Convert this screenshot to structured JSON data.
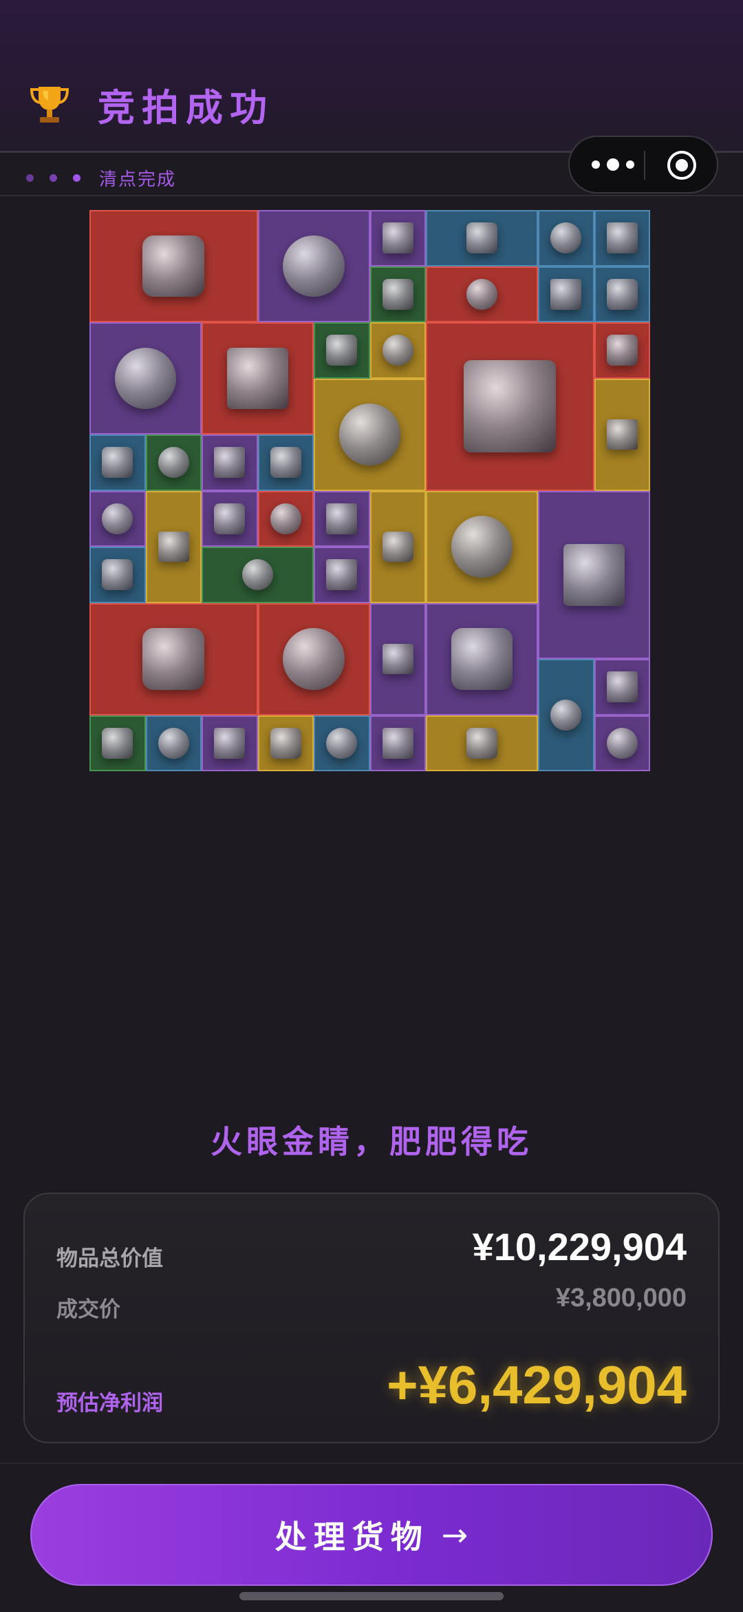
{
  "header": {
    "title": "竞拍成功",
    "subtitle": "清点完成",
    "trophy_icon": "trophy-icon"
  },
  "capsule": {
    "more_icon": "more-dots-icon",
    "close_icon": "target-close-icon"
  },
  "items_grid": {
    "rarity_colors": {
      "red": "#a8342e",
      "purple": "#5d3b83",
      "blue": "#2d5a78",
      "gold": "#a48122",
      "green": "#2c5b33"
    },
    "items": [
      {
        "name": "server-unit",
        "rarity": "red"
      },
      {
        "name": "coffee-machine",
        "rarity": "purple"
      },
      {
        "name": "circuit-module",
        "rarity": "purple"
      },
      {
        "name": "assault-rifle",
        "rarity": "blue"
      },
      {
        "name": "smart-watch",
        "rarity": "blue"
      },
      {
        "name": "playing-card",
        "rarity": "blue"
      },
      {
        "name": "medicine-bottle",
        "rarity": "green"
      },
      {
        "name": "tablet-device",
        "rarity": "red"
      },
      {
        "name": "computer-mouse",
        "rarity": "blue"
      },
      {
        "name": "pill-bottle",
        "rarity": "blue"
      },
      {
        "name": "circular-saw",
        "rarity": "purple"
      },
      {
        "name": "oscilloscope",
        "rarity": "red"
      },
      {
        "name": "hard-drive",
        "rarity": "green"
      },
      {
        "name": "sauce-bottle",
        "rarity": "gold"
      },
      {
        "name": "jeweled-egg",
        "rarity": "red"
      },
      {
        "name": "fountain-pen",
        "rarity": "red"
      },
      {
        "name": "fuel-jug",
        "rarity": "gold"
      },
      {
        "name": "leather-journal",
        "rarity": "gold"
      },
      {
        "name": "ammo-box",
        "rarity": "blue"
      },
      {
        "name": "battery-pack",
        "rarity": "green"
      },
      {
        "name": "tripod-mount",
        "rarity": "purple"
      },
      {
        "name": "data-disc",
        "rarity": "blue"
      },
      {
        "name": "tactical-knife",
        "rarity": "purple"
      },
      {
        "name": "lighter-canister",
        "rarity": "gold"
      },
      {
        "name": "circuit-board",
        "rarity": "purple"
      },
      {
        "name": "gold-watch",
        "rarity": "red"
      },
      {
        "name": "dagger",
        "rarity": "purple"
      },
      {
        "name": "lighter-canister-2",
        "rarity": "gold"
      },
      {
        "name": "satellite-dish",
        "rarity": "gold"
      },
      {
        "name": "security-camera",
        "rarity": "purple"
      },
      {
        "name": "usb-stick",
        "rarity": "blue"
      },
      {
        "name": "old-map",
        "rarity": "green"
      },
      {
        "name": "snack-bar",
        "rarity": "purple"
      },
      {
        "name": "laptop",
        "rarity": "red"
      },
      {
        "name": "drone",
        "rarity": "red"
      },
      {
        "name": "golden-vase",
        "rarity": "purple"
      },
      {
        "name": "motherboard",
        "rarity": "purple"
      },
      {
        "name": "confidential-file",
        "rarity": "blue"
      },
      {
        "name": "metal-ring",
        "rarity": "purple"
      },
      {
        "name": "wire-coil",
        "rarity": "green"
      },
      {
        "name": "smart-watch-2",
        "rarity": "blue"
      },
      {
        "name": "moss-dish",
        "rarity": "purple"
      },
      {
        "name": "gold-necklace",
        "rarity": "gold"
      },
      {
        "name": "ration-can",
        "rarity": "blue"
      },
      {
        "name": "tea-cup",
        "rarity": "purple"
      },
      {
        "name": "crossbow",
        "rarity": "gold"
      },
      {
        "name": "silver-oval",
        "rarity": "purple"
      }
    ]
  },
  "slogan": "火眼金睛，肥肥得吃",
  "summary": {
    "total_label": "物品总价值",
    "total_value": "¥10,229,904",
    "deal_label": "成交价",
    "deal_value": "¥3,800,000",
    "profit_label": "预估净利润",
    "profit_value": "+¥6,429,904"
  },
  "action": {
    "label": "处理货物",
    "arrow": "→"
  }
}
